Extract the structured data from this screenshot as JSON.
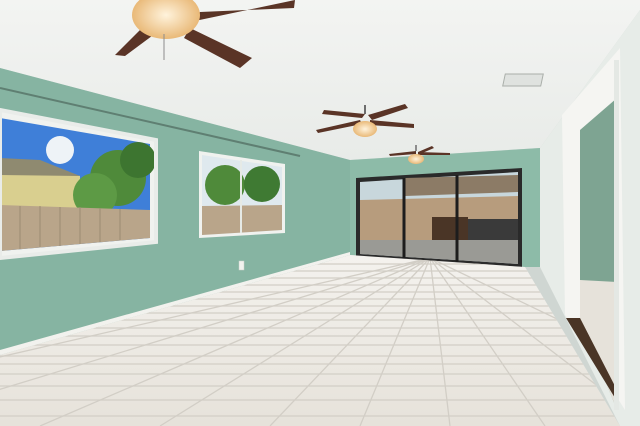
{
  "scene": {
    "description_free": true,
    "colors": {
      "ceiling": "#f4f5f3",
      "wall_green": "#86b4a2",
      "wall_green_dark": "#6f9f8d",
      "right_wall": "#e9eeea",
      "floor": "#ece9e3",
      "grout": "#d2cec6",
      "baseboard": "#f2f2ee",
      "door_trim": "#f5f5f2",
      "hallway_wall": "#7ea492",
      "wood_threshold": "#4a3526",
      "fan_blade": "#5a3426",
      "fan_light": "#f1d3a6",
      "sky": "#3f7fd8",
      "fence": "#b9a58a",
      "tree": "#4f8a3a",
      "house_yellow": "#d9cf8f"
    }
  }
}
